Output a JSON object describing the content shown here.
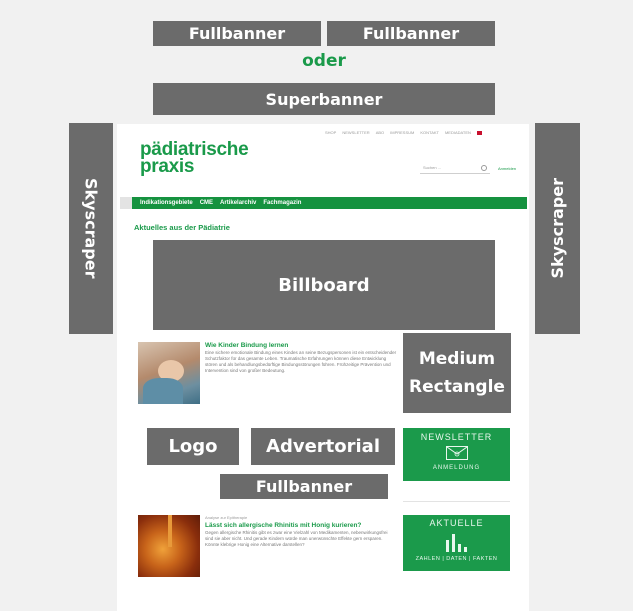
{
  "colors": {
    "ad_grey": "#6b6b6b",
    "brand_green": "#1a9a4a",
    "background": "#f1f1f1"
  },
  "ads": {
    "fullbanner_1": "Fullbanner",
    "fullbanner_2": "Fullbanner",
    "oder": "oder",
    "superbanner": "Superbanner",
    "skyscraper_left": "Skyscraper",
    "skyscraper_right": "Skyscraper",
    "billboard": "Billboard",
    "medium_rectangle": "Medium Rectangle",
    "logo": "Logo",
    "advertorial": "Advertorial",
    "fullbanner_3": "Fullbanner"
  },
  "site": {
    "logo_line1": "pädiatrische",
    "logo_line2": "praxis",
    "topnav": [
      "SHOP",
      "NEWSLETTER",
      "ABO",
      "IMPRESSUM",
      "KONTAKT",
      "MEDIADATEN"
    ],
    "search_placeholder": "Suchen ...",
    "login": "Anmelden",
    "nav": [
      "Indikationsgebiete",
      "CME",
      "Artikelarchiv",
      "Fachmagazin"
    ],
    "section_title": "Aktuelles aus der Pädiatrie"
  },
  "articles": [
    {
      "kicker": "",
      "title": "Wie Kinder Bindung lernen",
      "text": "Eine sichere emotionale Bindung eines Kindes an seine Bezugspersonen ist ein entscheidender Schutzfaktor für das gesamte Leben. Traumatische Erfahrungen können diese Entwicklung stören und als behandlungsbedürftige Bindungsstörungen führen. Frühzeitige Prävention und Intervention sind von großer Bedeutung."
    },
    {
      "kicker": "Analyse zur Epitherapie",
      "title": "Lässt sich allergische Rhinitis mit Honig kurieren?",
      "text": "Gegen allergische Rhinitis gibt es zwar eine Vielzahl von Medikamenten, nebenwirkungsfrei sind sie aber nicht. Und gerade Kindern würde man unerwünschte Effekte gern ersparen. Könnte klebrige Honig eine Alternative darstellen?"
    }
  ],
  "widgets": {
    "newsletter_title": "NEWSLETTER",
    "newsletter_sub": "ANMELDUNG",
    "aktuelle_title": "AKTUELLE",
    "aktuelle_sub": "ZAHLEN | DATEN | FAKTEN"
  }
}
